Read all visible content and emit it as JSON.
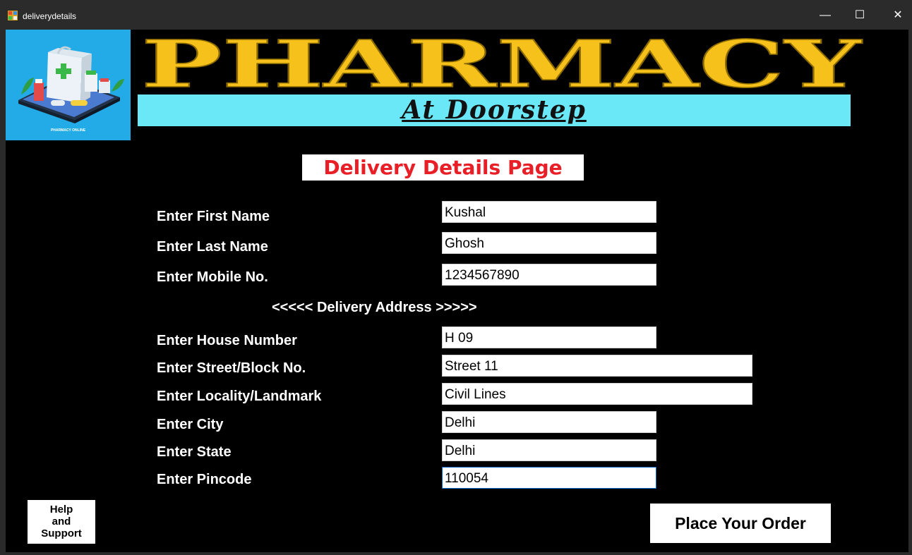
{
  "window": {
    "title": "deliverydetails",
    "minimize_glyph": "—",
    "maximize_glyph": "☐",
    "close_glyph": "✕"
  },
  "logo": {
    "caption": "PHARMACY ONLINE",
    "bag_text": "PHARMACY"
  },
  "banner": {
    "title": "PHARMACY",
    "tagline": "At Doorstep",
    "title_color": "#f5c11a",
    "tagline_bg": "#6be8f7"
  },
  "page_heading": "Delivery Details Page",
  "form": {
    "first_name": {
      "label": "Enter First Name",
      "value": "Kushal"
    },
    "last_name": {
      "label": "Enter Last Name",
      "value": "Ghosh"
    },
    "mobile": {
      "label": "Enter Mobile No.",
      "value": "1234567890"
    },
    "address_header": "<<<<< Delivery Address >>>>>",
    "house": {
      "label": "Enter House Number",
      "value": "H 09"
    },
    "street": {
      "label": "Enter Street/Block No.",
      "value": "Street 11"
    },
    "locality": {
      "label": "Enter Locality/Landmark",
      "value": "Civil Lines"
    },
    "city": {
      "label": "Enter City",
      "value": "Delhi"
    },
    "state": {
      "label": "Enter State",
      "value": "Delhi"
    },
    "pincode": {
      "label": "Enter Pincode",
      "value": "110054"
    }
  },
  "buttons": {
    "help_line1": "Help",
    "help_line2": "and",
    "help_line3": "Support",
    "place_order": "Place Your Order"
  },
  "colors": {
    "heading_red": "#e81f27",
    "logo_bg": "#22abe6",
    "background": "#000000"
  }
}
